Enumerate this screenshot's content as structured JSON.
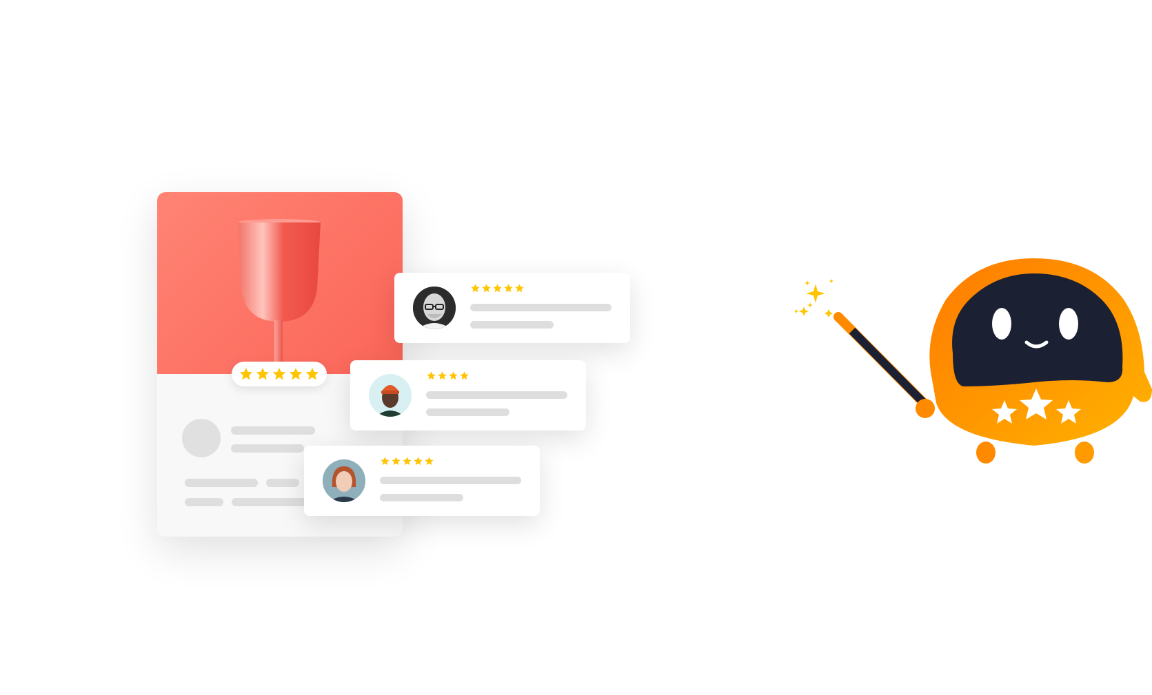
{
  "colors": {
    "hero": "#fb6558",
    "star": "#ffc400",
    "skeleton": "#dedede",
    "mascot_orange": "#ff8a00",
    "mascot_face": "#1b2033"
  },
  "product": {
    "rating_stars": 5
  },
  "reviews": [
    {
      "avatar": "reviewer-bald-man-with-glasses",
      "stars": 5
    },
    {
      "avatar": "reviewer-man-with-orange-beanie",
      "stars": 4
    },
    {
      "avatar": "reviewer-red-haired-woman",
      "stars": 5
    }
  ],
  "mascot": {
    "icon": "orange-robot-with-magic-wand",
    "belly_stars": 3
  }
}
